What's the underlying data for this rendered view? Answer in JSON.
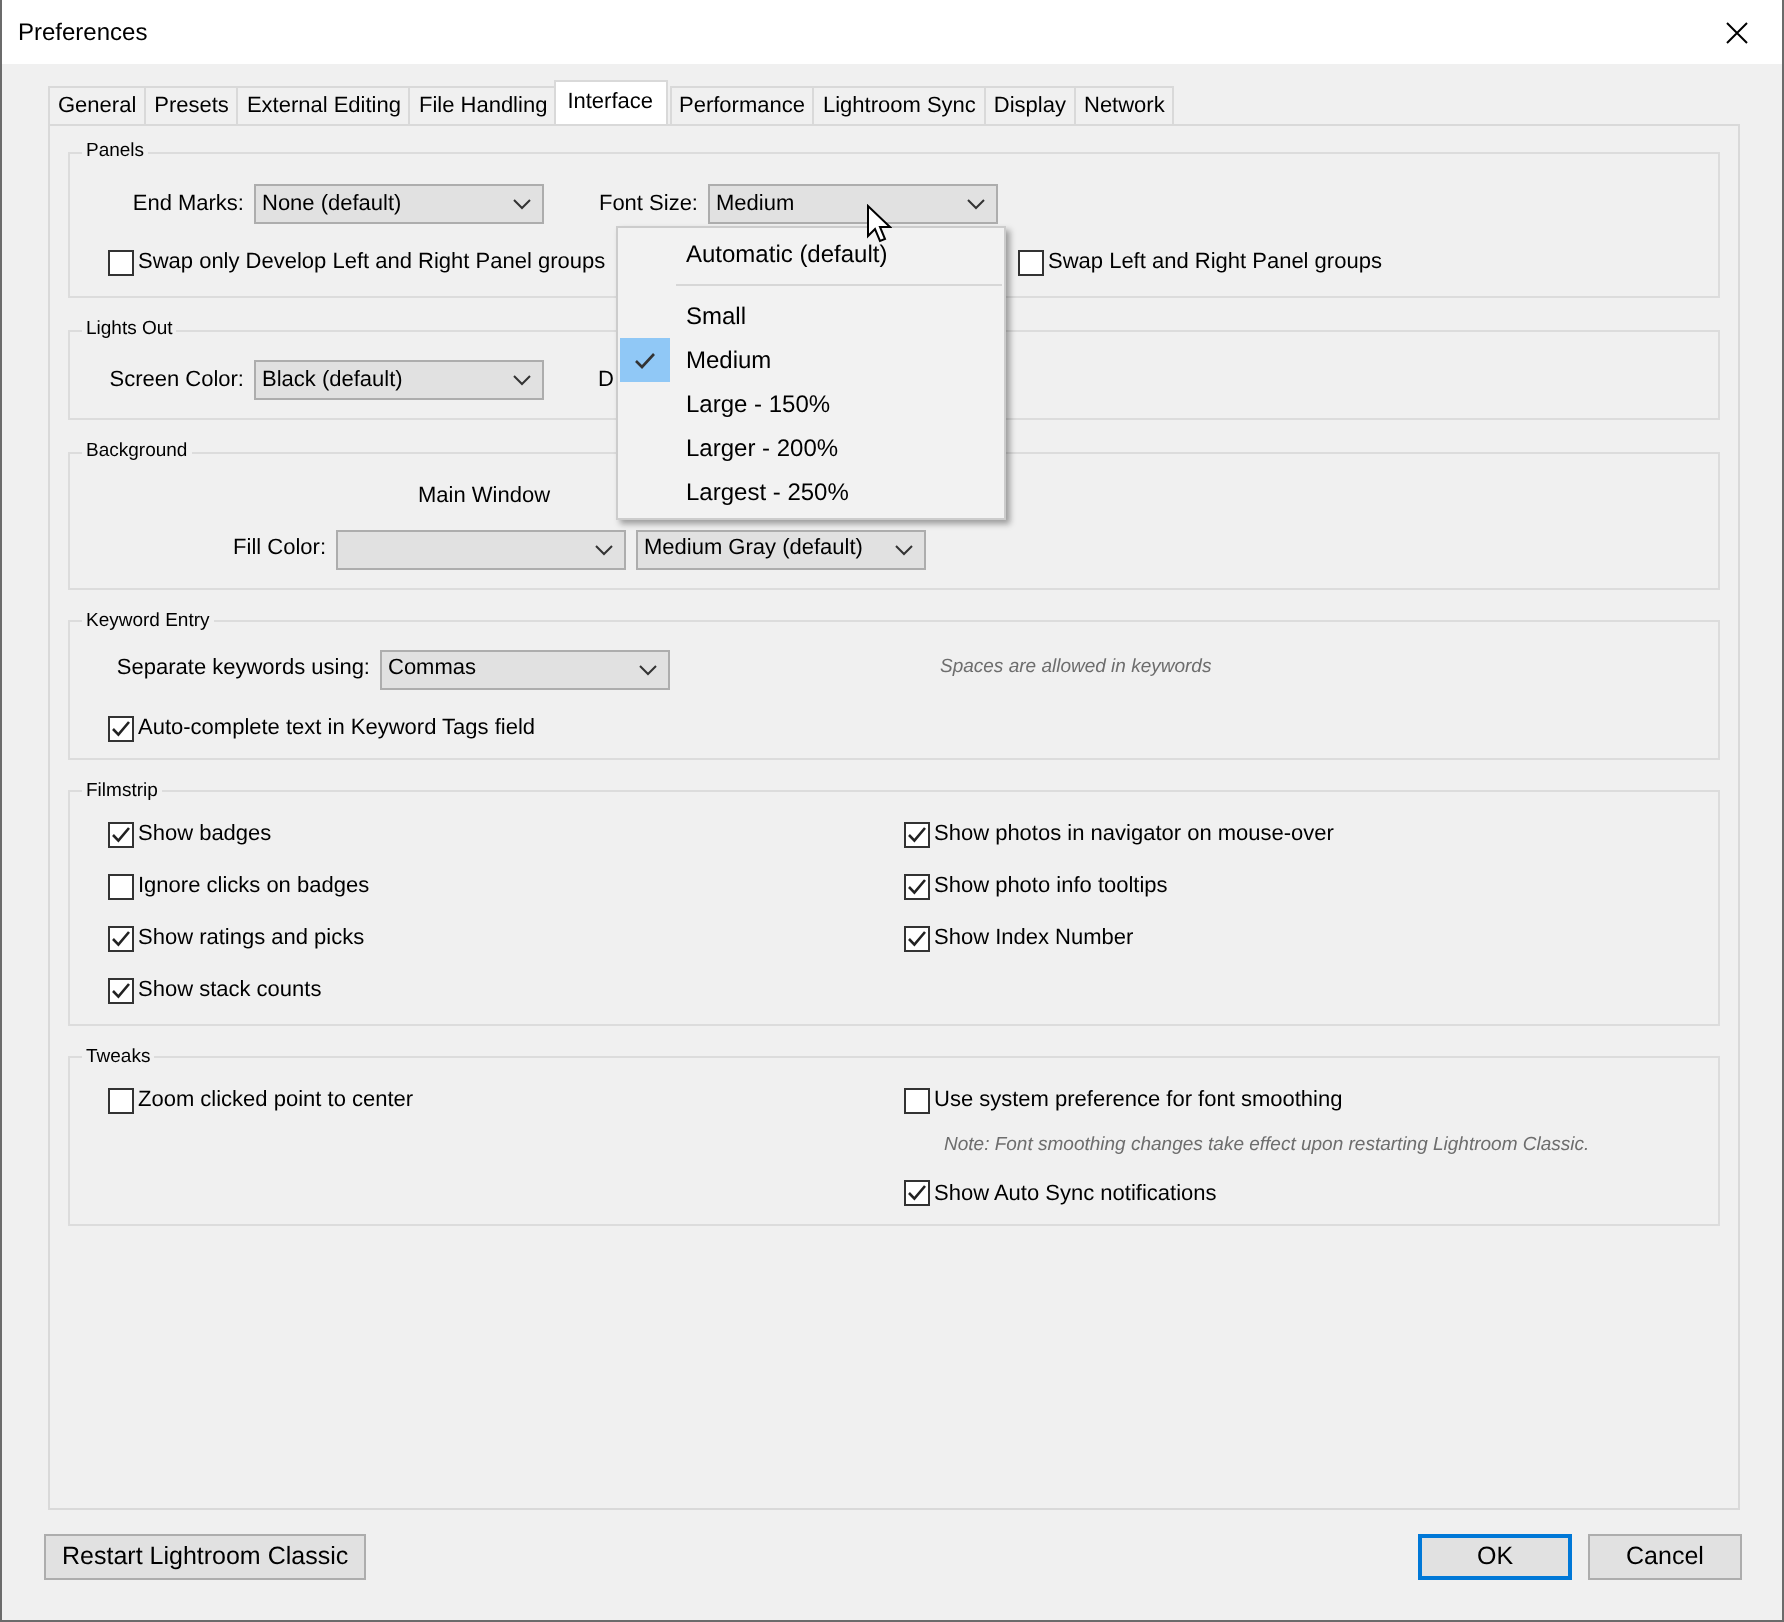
{
  "window": {
    "title": "Preferences"
  },
  "tabs": [
    {
      "label": "General",
      "selected": false
    },
    {
      "label": "Presets",
      "selected": false
    },
    {
      "label": "External Editing",
      "selected": false
    },
    {
      "label": "File Handling",
      "selected": false
    },
    {
      "label": "Interface",
      "selected": true
    },
    {
      "label": "Performance",
      "selected": false
    },
    {
      "label": "Lightroom Sync",
      "selected": false
    },
    {
      "label": "Display",
      "selected": false
    },
    {
      "label": "Network",
      "selected": false
    }
  ],
  "panels": {
    "title": "Panels",
    "end_marks": {
      "label": "End Marks:",
      "value": "None (default)"
    },
    "font_size": {
      "label": "Font Size:",
      "value": "Medium"
    },
    "checkboxes": [
      {
        "label": "Swap only Develop Left and Right Panel groups",
        "checked": false
      },
      {
        "label": "Swap Left and Right Panel groups",
        "checked": false
      }
    ]
  },
  "font_size_menu": {
    "items": [
      {
        "label": "Automatic (default)",
        "selected": false,
        "separator_after": true
      },
      {
        "label": "Small",
        "selected": false,
        "separator_after": false
      },
      {
        "label": "Medium",
        "selected": true,
        "separator_after": false
      },
      {
        "label": "Large - 150%",
        "selected": false,
        "separator_after": false
      },
      {
        "label": "Larger - 200%",
        "selected": false,
        "separator_after": false
      },
      {
        "label": "Largest - 250%",
        "selected": false,
        "separator_after": false
      }
    ]
  },
  "lights_out": {
    "title": "Lights Out",
    "screen_color": {
      "label": "Screen Color:",
      "value": "Black (default)"
    },
    "cut_label": "D"
  },
  "background": {
    "title": "Background",
    "column_heading": "Main Window",
    "fill_color": {
      "label": "Fill Color:",
      "options": [
        "Medium Gray (default)"
      ]
    }
  },
  "keyword_entry": {
    "title": "Keyword Entry",
    "separator": {
      "label": "Separate keywords using:",
      "value": "Commas"
    },
    "hint": "Spaces are allowed in keywords",
    "checkbox": {
      "label": "Auto-complete text in Keyword Tags field",
      "checked": true
    }
  },
  "filmstrip": {
    "title": "Filmstrip",
    "left": [
      {
        "label": "Show badges",
        "checked": true
      },
      {
        "label": "Ignore clicks on badges",
        "checked": false
      },
      {
        "label": "Show ratings and picks",
        "checked": true
      },
      {
        "label": "Show stack counts",
        "checked": true
      }
    ],
    "right": [
      {
        "label": "Show photos in navigator on mouse-over",
        "checked": true
      },
      {
        "label": "Show photo info tooltips",
        "checked": true
      },
      {
        "label": "Show Index Number",
        "checked": true
      }
    ]
  },
  "tweaks": {
    "title": "Tweaks",
    "left": [
      {
        "kind": "checkbox",
        "label": "Zoom clicked point to center",
        "checked": false
      }
    ],
    "right": [
      {
        "kind": "checkbox",
        "label": "Use system preference for font smoothing",
        "checked": false
      },
      {
        "kind": "note",
        "label": "Note: Font smoothing changes take effect upon restarting Lightroom Classic."
      },
      {
        "kind": "checkbox",
        "label": "Show Auto Sync notifications",
        "checked": true
      }
    ]
  },
  "buttons": [
    {
      "label": "Restart Lightroom Classic",
      "default": false
    },
    {
      "label": "OK",
      "default": true
    },
    {
      "label": "Cancel",
      "default": false
    }
  ]
}
